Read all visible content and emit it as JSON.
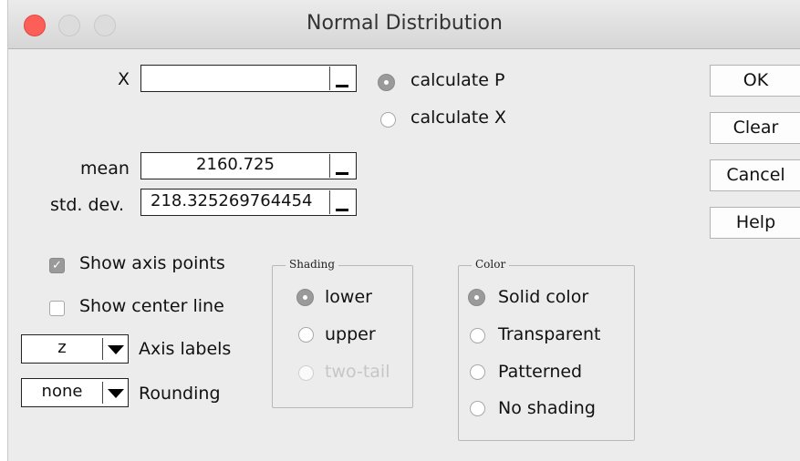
{
  "window": {
    "title": "Normal Distribution"
  },
  "fields": {
    "x": {
      "label": "X",
      "value": ""
    },
    "mean": {
      "label": "mean",
      "value": "2160.725"
    },
    "std_dev": {
      "label": "std. dev.",
      "value": "218.325269764454"
    }
  },
  "mode": {
    "calc_p": {
      "label": "calculate P",
      "selected": true
    },
    "calc_x": {
      "label": "calculate X",
      "selected": false
    }
  },
  "buttons": {
    "ok": "OK",
    "clear": "Clear",
    "cancel": "Cancel",
    "help": "Help"
  },
  "options": {
    "show_axis_points": {
      "label": "Show axis points",
      "checked": true
    },
    "show_center_line": {
      "label": "Show center line",
      "checked": false
    }
  },
  "axis_labels": {
    "label": "Axis labels",
    "value": "z"
  },
  "rounding": {
    "label": "Rounding",
    "value": "none"
  },
  "shading": {
    "title": "Shading",
    "options": [
      {
        "label": "lower",
        "selected": true,
        "enabled": true
      },
      {
        "label": "upper",
        "selected": false,
        "enabled": true
      },
      {
        "label": "two-tail",
        "selected": false,
        "enabled": false
      }
    ]
  },
  "color": {
    "title": "Color",
    "options": [
      {
        "label": "Solid color",
        "selected": true
      },
      {
        "label": "Transparent",
        "selected": false
      },
      {
        "label": "Patterned",
        "selected": false
      },
      {
        "label": "No shading",
        "selected": false
      }
    ]
  }
}
